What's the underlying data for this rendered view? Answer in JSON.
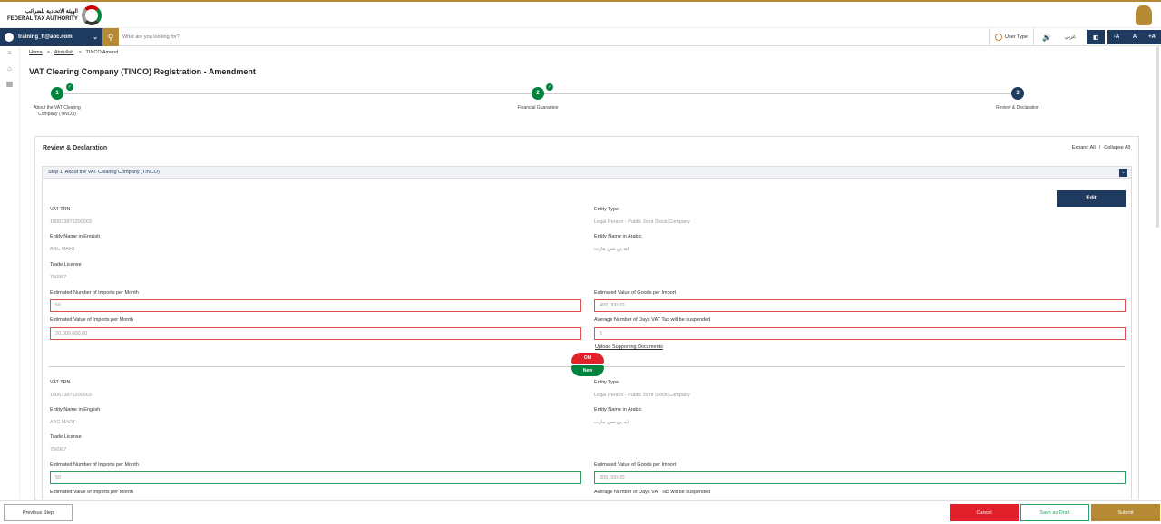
{
  "header": {
    "logo_arabic": "الهيئة الاتحادية للضرائب",
    "logo_english": "FEDERAL TAX AUTHORITY"
  },
  "navbar": {
    "user_email": "training_ft@abc.com",
    "search_placeholder": "What are you looking for?",
    "user_type": "User Type",
    "speaker": "🔊",
    "arabic": "عربي",
    "contrast": "◧",
    "font_minus": "-A",
    "font_normal": "A",
    "font_plus": "+A"
  },
  "breadcrumb": {
    "home": "Home",
    "user": "Abdullah",
    "current": "TINCO Amend"
  },
  "page_title": "VAT Clearing Company (TINCO) Registration - Amendment",
  "steps": [
    {
      "num": "1",
      "label": "About the VAT Clearing Company (TINCO)"
    },
    {
      "num": "2",
      "label": "Financial Guarantee"
    },
    {
      "num": "3",
      "label": "Review & Declaration"
    }
  ],
  "panel": {
    "title": "Review & Declaration",
    "expand_all": "Expand All",
    "separator": "/",
    "collapse_all": "Collapse All",
    "accordion_title": "Step 1: About the VAT Clearing Company (TINCO)",
    "edit": "Edit"
  },
  "old": {
    "vat_trn_label": "VAT TRN",
    "vat_trn": "100633876200003",
    "entity_type_label": "Entity Type",
    "entity_type": "Legal Person - Public Joint Stock Company",
    "name_en_label": "Entity Name in English",
    "name_en": "ABC MART",
    "name_ar_label": "Entity Name in Arabic",
    "name_ar": "ايه بي سي مارت",
    "trade_label": "Trade License",
    "trade": "756987",
    "imports_label": "Estimated Number of Imports per Month",
    "imports": "50",
    "goods_label": "Estimated Value of Goods per Import",
    "goods": "400,000.00",
    "value_label": "Estimated Value of Imports per Month",
    "value": "20,000,000.00",
    "days_label": "Average Number of Days VAT Tax will be suspended",
    "days": "5",
    "upload": "Upload Supporting Documents"
  },
  "badges": {
    "old": "Old",
    "new": "New"
  },
  "new": {
    "vat_trn_label": "VAT TRN",
    "vat_trn": "100633876200003",
    "entity_type_label": "Entity Type",
    "entity_type": "Legal Person - Public Joint Stock Company",
    "name_en_label": "Entity Name in English",
    "name_en": "ABC MART",
    "name_ar_label": "Entity Name in Arabic",
    "name_ar": "ايه بي سي مارت",
    "trade_label": "Trade License",
    "trade": "756987",
    "imports_label": "Estimated Number of Imports per Month",
    "imports": "50",
    "goods_label": "Estimated Value of Goods per Import",
    "goods": "300,000.00",
    "value_label": "Estimated Value of Imports per Month",
    "days_label": "Average Number of Days VAT Tax will be suspended"
  },
  "footer": {
    "previous": "Previous Step",
    "cancel": "Cancel",
    "draft": "Save as Draft",
    "submit": "Submit"
  },
  "colors": {
    "primary": "#1e3a5f",
    "gold": "#b68a35",
    "success": "#00843d",
    "danger": "#e0202a"
  }
}
